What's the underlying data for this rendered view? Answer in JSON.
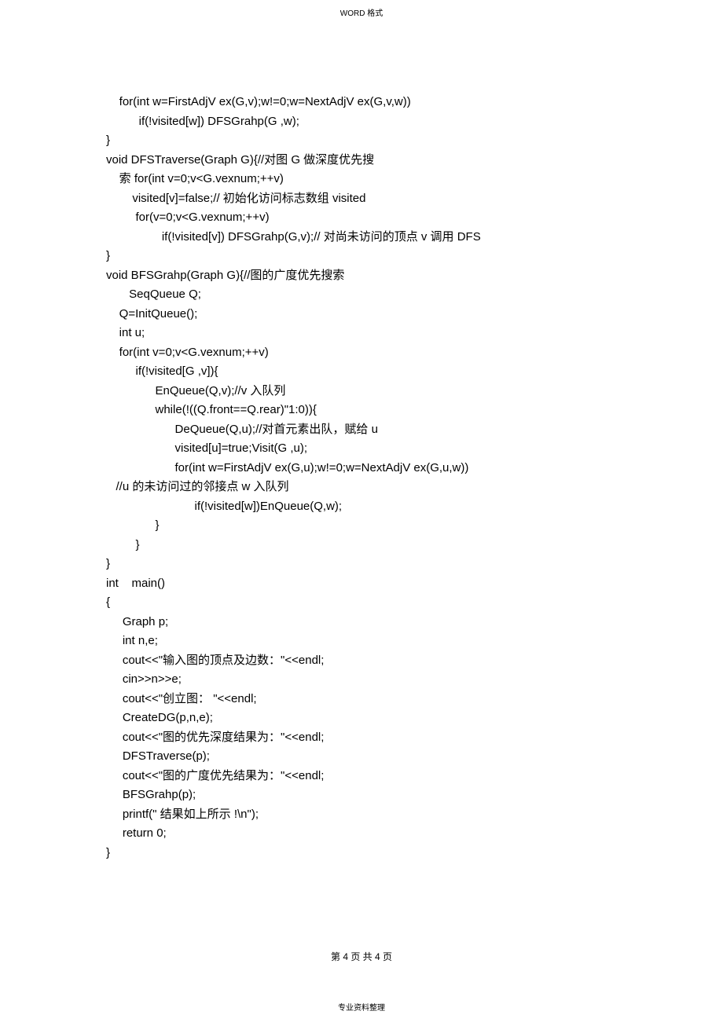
{
  "header": "WORD 格式",
  "code": "    for(int w=FirstAdjV ex(G,v);w!=0;w=NextAdjV ex(G,v,w))\n          if(!visited[w]) DFSGrahp(G ,w);\n}\nvoid DFSTraverse(Graph G){//对图 G 做深度优先搜\n    索 for(int v=0;v<G.vexnum;++v)\n        visited[v]=false;// 初始化访问标志数组 visited\n         for(v=0;v<G.vexnum;++v)\n                 if(!visited[v]) DFSGrahp(G,v);// 对尚未访问的顶点 v 调用 DFS\n}\nvoid BFSGrahp(Graph G){//图的广度优先搜索\n       SeqQueue Q;\n    Q=InitQueue();\n    int u;\n    for(int v=0;v<G.vexnum;++v)\n         if(!visited[G ,v]){\n               EnQueue(Q,v);//v 入队列\n               while(!((Q.front==Q.rear)\"1:0)){\n                     DeQueue(Q,u);//对首元素出队，赋给 u\n                     visited[u]=true;Visit(G ,u);\n                     for(int w=FirstAdjV ex(G,u);w!=0;w=NextAdjV ex(G,u,w))\n   //u 的未访问过的邻接点 w 入队列\n                           if(!visited[w])EnQueue(Q,w);\n               }\n         }\n}\nint    main()\n{\n     Graph p;\n     int n,e;\n     cout<<\"输入图的顶点及边数：\"<<endl;\n     cin>>n>>e;\n     cout<<\"创立图： \"<<endl;\n     CreateDG(p,n,e);\n     cout<<\"图的优先深度结果为：\"<<endl;\n     DFSTraverse(p);\n     cout<<\"图的广度优先结果为：\"<<endl;\n     BFSGrahp(p);\n     printf(\" 结果如上所示 !\\n\");\n     return 0;\n}",
  "page_number": "第 4 页 共 4 页",
  "footer": "专业资料整理"
}
